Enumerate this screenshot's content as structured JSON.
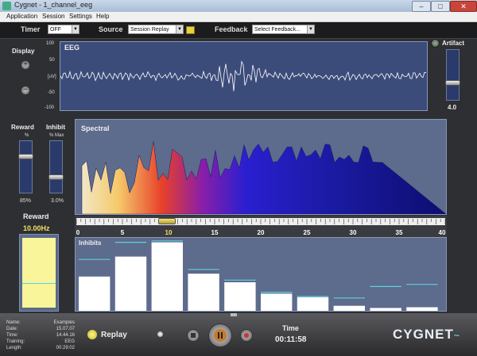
{
  "window": {
    "title": "Cygnet - 1_channel_eeg"
  },
  "menu": [
    "Application",
    "Session",
    "Settings",
    "Help"
  ],
  "toolbar": {
    "timer_label": "Timer",
    "timer_value": "OFF",
    "source_label": "Source",
    "source_value": "Session Replay",
    "feedback_label": "Feedback",
    "feedback_value": "Select Feedback..."
  },
  "display": {
    "label": "Display",
    "plus": "+",
    "minus": "−"
  },
  "eeg": {
    "label": "EEG",
    "y_ticks": [
      "100",
      "50",
      "[uV]",
      "-50",
      "-100"
    ],
    "unit": "[uV]"
  },
  "artifact": {
    "label": "Artifact",
    "value": "4.0",
    "level": 0.4
  },
  "reward_slider": {
    "label": "Reward",
    "unit": "%",
    "value": "85%",
    "level": 0.85
  },
  "inhibit_slider": {
    "label": "Inhibit",
    "unit": "% Max",
    "value": "3.0%",
    "level": 0.3
  },
  "spectral": {
    "label": "Spectral"
  },
  "freq_axis": {
    "ticks": [
      "0",
      "5",
      "10",
      "15",
      "20",
      "25",
      "30",
      "35",
      "40"
    ],
    "marker": 10
  },
  "reward_box": {
    "label": "Reward",
    "freq": "10.00Hz",
    "level": 0.38
  },
  "inhibits": {
    "label": "Inhibits",
    "bars": [
      0.48,
      0.76,
      0.96,
      0.52,
      0.4,
      0.24,
      0.19,
      0.07,
      0.04,
      0.05
    ],
    "thresholds": [
      0.72,
      0.96,
      0.98,
      0.58,
      0.43,
      0.26,
      0.2,
      0.18,
      0.34,
      0.37
    ]
  },
  "session_info": [
    {
      "k": "Name:",
      "v": "Examples"
    },
    {
      "k": "Date:",
      "v": "15.07.07"
    },
    {
      "k": "Time:",
      "v": "14.44.16"
    },
    {
      "k": "Training:",
      "v": "EEG"
    },
    {
      "k": "Length:",
      "v": "00:29:02"
    }
  ],
  "replay": {
    "label": "Replay"
  },
  "time": {
    "label": "Time",
    "value": "00:11:58"
  },
  "brand": {
    "name": "CYGNET"
  },
  "colors": {
    "panel": "#5a6a8a",
    "eeg_bg": "#3c4c7a",
    "reward_fill": "#f8f59a",
    "threshold": "#5fd0e0"
  }
}
